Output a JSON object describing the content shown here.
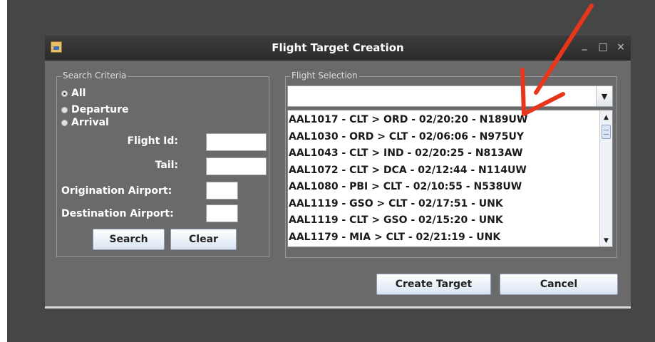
{
  "window": {
    "title": "Flight Target Creation",
    "minimize_glyph": "_",
    "maximize_glyph": "□",
    "close_glyph": "×"
  },
  "search_criteria": {
    "group_label": "Search Criteria",
    "radios": [
      {
        "label": "All",
        "selected": true
      },
      {
        "label": "Departure",
        "selected": false
      },
      {
        "label": "Arrival",
        "selected": false
      }
    ],
    "fields": {
      "flight_id": {
        "label": "Flight Id:",
        "value": ""
      },
      "tail": {
        "label": "Tail:",
        "value": ""
      },
      "origination_airport": {
        "label": "Origination Airport:",
        "value": ""
      },
      "destination_airport": {
        "label": "Destination Airport:",
        "value": ""
      }
    },
    "search_label": "Search",
    "clear_label": "Clear"
  },
  "flight_selection": {
    "group_label": "Flight Selection",
    "selected_value": "",
    "items": [
      "AAL1017 - CLT > ORD - 02/20:20 - N189UW",
      "AAL1030 - ORD > CLT - 02/06:06 - N975UY",
      "AAL1043 - CLT > IND - 02/20:25 - N813AW",
      "AAL1072 - CLT > DCA - 02/12:44 - N114UW",
      "AAL1080 - PBI > CLT - 02/10:55 - N538UW",
      "AAL1119 - GSO > CLT - 02/17:51 - UNK",
      "AAL1119 - CLT > GSO - 02/15:20 - UNK",
      "AAL1179 - MIA > CLT - 02/21:19 - UNK"
    ]
  },
  "buttons": {
    "create_target_label": "Create Target",
    "cancel_label": "Cancel"
  },
  "colors": {
    "annotation_arrow": "#e8361c",
    "window_body": "#6a6a6a",
    "titlebar": "#2f2f2f"
  },
  "icons": {
    "app": "java-app-icon",
    "combo": "dropdown-arrow-icon",
    "annotation": "red-arrow"
  }
}
